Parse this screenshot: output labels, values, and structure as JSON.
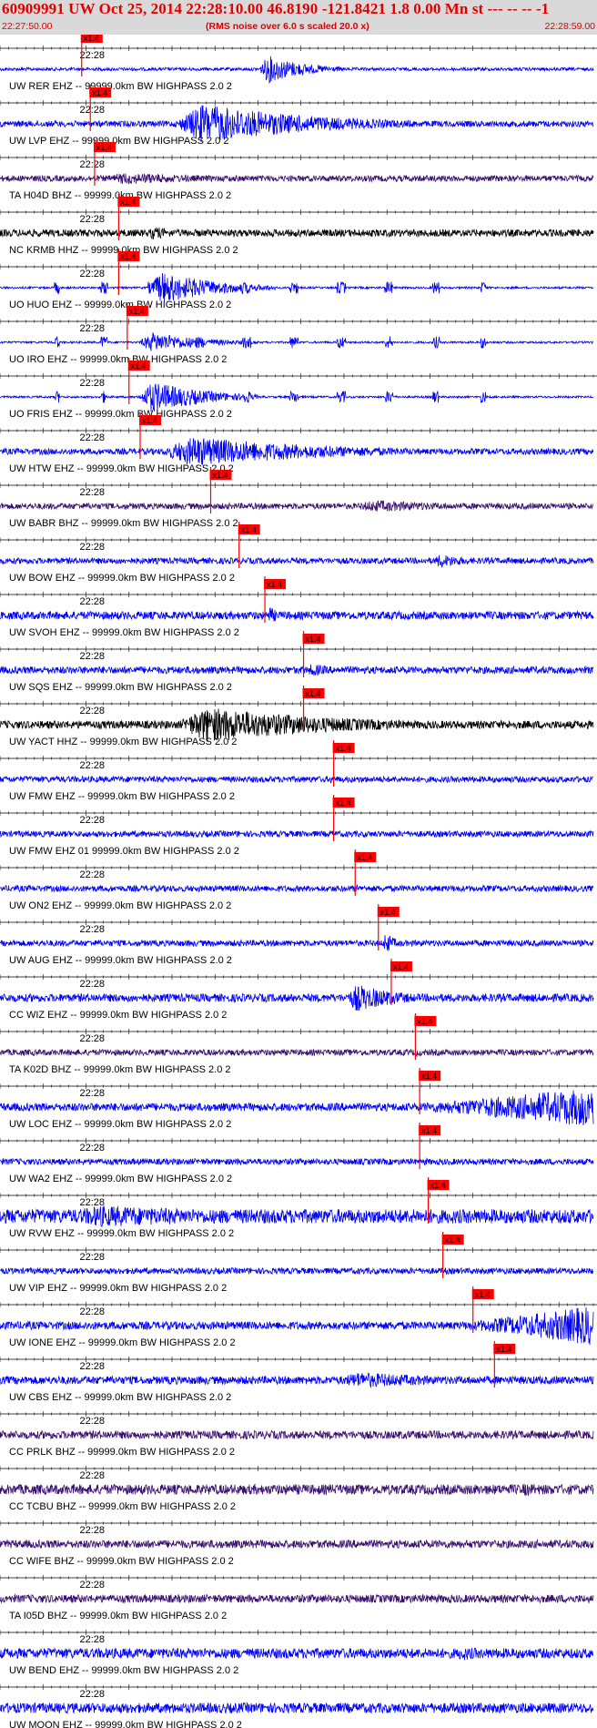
{
  "header": {
    "title": "60909991 UW Oct 25, 2014 22:28:10.00   46.8190 -121.8421  1.8 0.00 Mn st --- -- --   -1",
    "start_time": "22:27:50.00",
    "note": "(RMS noise over 6.0 s scaled 20.0 x)",
    "end_time": "22:28:59.00"
  },
  "colors": {
    "header_bg": "#d9d9d9",
    "header_text": "#e00000",
    "pick_marker": "#ff0000",
    "trace_blue": "#0000ff",
    "trace_dark": "#000000",
    "trace_purple": "#3a1070"
  },
  "chart_data": {
    "type": "line",
    "x_unit": "seconds",
    "x_range": [
      "22:27:50.00",
      "22:28:59.00"
    ],
    "pick_label": "x1.4",
    "time_label": "22:28",
    "traces": [
      {
        "label": "UW RER EHZ -- 99999.0km BW  HIGHPASS  2.0  2",
        "color": "blue",
        "pick": 9.5,
        "amp": 0.7,
        "noise": 0.08,
        "event_start": 30.0,
        "event_end": 40.0,
        "style": "normal"
      },
      {
        "label": "UW LVP EHZ -- 99999.0km BW  HIGHPASS  2.0  2",
        "color": "blue",
        "pick": 10.5,
        "amp": 1.0,
        "noise": 0.15,
        "event_start": 20.0,
        "event_end": 50.0,
        "style": "normal"
      },
      {
        "label": "TA H04D BHZ -- 99999.0km BW  HIGHPASS  2.0  2",
        "color": "purple",
        "pick": 11.0,
        "amp": 0.3,
        "noise": 0.15,
        "event_start": 11.0,
        "event_end": 40.0,
        "style": "normal"
      },
      {
        "label": "NC KRMB HHZ -- 99999.0km BW  HIGHPASS  2.0  2",
        "color": "dark",
        "pick": 13.8,
        "amp": 0.35,
        "noise": 0.18,
        "event_start": 17.0,
        "event_end": 24.0,
        "style": "normal"
      },
      {
        "label": "UO HUO EHZ -- 99999.0km BW  HIGHPASS  2.0  2",
        "color": "blue",
        "pick": 13.8,
        "amp": 0.8,
        "noise": 0.05,
        "event_start": 17.0,
        "event_end": 32.0,
        "style": "bursty"
      },
      {
        "label": "UO IRO EHZ -- 99999.0km BW  HIGHPASS  2.0  2",
        "color": "blue",
        "pick": 14.8,
        "amp": 0.5,
        "noise": 0.05,
        "event_start": 16.0,
        "event_end": 30.0,
        "style": "bursty"
      },
      {
        "label": "UO FRIS EHZ -- 99999.0km BW  HIGHPASS  2.0  2",
        "color": "blue",
        "pick": 15.0,
        "amp": 0.8,
        "noise": 0.05,
        "event_start": 16.0,
        "event_end": 30.0,
        "style": "bursty"
      },
      {
        "label": "UW HTW EHZ -- 99999.0km BW  HIGHPASS  2.0  2",
        "color": "blue",
        "pick": 16.3,
        "amp": 0.75,
        "noise": 0.15,
        "event_start": 18.0,
        "event_end": 55.0,
        "style": "normal"
      },
      {
        "label": "UW BABR BHZ -- 99999.0km BW  HIGHPASS  2.0  2",
        "color": "purple",
        "pick": 24.5,
        "amp": 0.3,
        "noise": 0.15,
        "event_start": 40.0,
        "event_end": 69.0,
        "style": "normal"
      },
      {
        "label": "UW BOW EHZ -- 99999.0km BW  HIGHPASS  2.0  2",
        "color": "blue",
        "pick": 27.8,
        "amp": 0.35,
        "noise": 0.15,
        "event_start": 50.0,
        "event_end": 60.0,
        "style": "normal"
      },
      {
        "label": "UW SVOH EHZ -- 99999.0km BW  HIGHPASS  2.0  2",
        "color": "blue",
        "pick": 30.8,
        "amp": 0.45,
        "noise": 0.2,
        "event_start": 31.0,
        "event_end": 34.0,
        "style": "normal"
      },
      {
        "label": "UW SQS EHZ -- 99999.0km BW  HIGHPASS  2.0  2",
        "color": "blue",
        "pick": 35.3,
        "amp": 0.35,
        "noise": 0.18,
        "event_start": 35.5,
        "event_end": 42.0,
        "style": "normal"
      },
      {
        "label": "UW YACT HHZ -- 99999.0km BW  HIGHPASS  2.0  2",
        "color": "dark",
        "pick": 35.3,
        "amp": 0.9,
        "noise": 0.2,
        "event_start": 20.0,
        "event_end": 55.0,
        "style": "normal"
      },
      {
        "label": "UW FMW EHZ -- 99999.0km BW  HIGHPASS  2.0  2",
        "color": "blue",
        "pick": 38.8,
        "amp": 0.2,
        "noise": 0.15,
        "event_start": 38.0,
        "event_end": 42.0,
        "style": "normal"
      },
      {
        "label": "UW FMW EHZ 01 99999.0km BW  HIGHPASS  2.0  2",
        "color": "blue",
        "pick": 38.8,
        "amp": 0.2,
        "noise": 0.15,
        "event_start": 38.0,
        "event_end": 42.0,
        "style": "normal"
      },
      {
        "label": "UW ON2 EHZ -- 99999.0km BW  HIGHPASS  2.0  2",
        "color": "blue",
        "pick": 41.3,
        "amp": 0.2,
        "noise": 0.15,
        "event_start": 41.0,
        "event_end": 45.0,
        "style": "normal"
      },
      {
        "label": "UW AUG EHZ -- 99999.0km BW  HIGHPASS  2.0  2",
        "color": "blue",
        "pick": 44.0,
        "amp": 0.6,
        "noise": 0.15,
        "event_start": 44.5,
        "event_end": 47.0,
        "style": "normal"
      },
      {
        "label": "CC WIZ EHZ -- 99999.0km BW  HIGHPASS  2.0  2",
        "color": "blue",
        "pick": 45.5,
        "amp": 0.7,
        "noise": 0.2,
        "event_start": 40.0,
        "event_end": 52.0,
        "style": "normal"
      },
      {
        "label": "TA K02D BHZ -- 99999.0km BW  HIGHPASS  2.0  2",
        "color": "purple",
        "pick": 48.3,
        "amp": 0.2,
        "noise": 0.15,
        "event_start": 48.0,
        "event_end": 52.0,
        "style": "normal"
      },
      {
        "label": "UW LOC EHZ -- 99999.0km BW  HIGHPASS  2.0  2",
        "color": "blue",
        "pick": 48.8,
        "amp": 1.0,
        "noise": 0.2,
        "event_start": 38.0,
        "event_end": 69.0,
        "style": "growing"
      },
      {
        "label": "UW WA2 EHZ -- 99999.0km BW  HIGHPASS  2.0  2",
        "color": "blue",
        "pick": 48.8,
        "amp": 0.2,
        "noise": 0.15,
        "event_start": 49.0,
        "event_end": 52.0,
        "style": "normal"
      },
      {
        "label": "UW RVW EHZ -- 99999.0km BW  HIGHPASS  2.0  2",
        "color": "blue",
        "pick": 49.8,
        "amp": 0.55,
        "noise": 0.35,
        "event_start": 5.0,
        "event_end": 60.0,
        "style": "normal"
      },
      {
        "label": "UW VIP EHZ -- 99999.0km BW  HIGHPASS  2.0  2",
        "color": "blue",
        "pick": 51.5,
        "amp": 0.2,
        "noise": 0.15,
        "event_start": 51.0,
        "event_end": 55.0,
        "style": "normal"
      },
      {
        "label": "UW IONE EHZ -- 99999.0km BW  HIGHPASS  2.0  2",
        "color": "blue",
        "pick": 55.0,
        "amp": 1.0,
        "noise": 0.2,
        "event_start": 46.0,
        "event_end": 69.0,
        "style": "growing"
      },
      {
        "label": "UW CBS EHZ -- 99999.0km BW  HIGHPASS  2.0  2",
        "color": "blue",
        "pick": 57.5,
        "amp": 0.4,
        "noise": 0.2,
        "event_start": 38.0,
        "event_end": 69.0,
        "style": "normal"
      },
      {
        "label": "CC PRLK BHZ -- 99999.0km BW  HIGHPASS  2.0  2",
        "color": "purple",
        "pick": null,
        "amp": 0.2,
        "noise": 0.2,
        "event_start": 0,
        "event_end": 0,
        "style": "normal"
      },
      {
        "label": "CC TCBU BHZ -- 99999.0km BW  HIGHPASS  2.0  2",
        "color": "purple",
        "pick": null,
        "amp": 0.35,
        "noise": 0.25,
        "event_start": 60.0,
        "event_end": 69.0,
        "style": "normal"
      },
      {
        "label": "CC WIFE BHZ -- 99999.0km BW  HIGHPASS  2.0  2",
        "color": "purple",
        "pick": null,
        "amp": 0.2,
        "noise": 0.2,
        "event_start": 0,
        "event_end": 0,
        "style": "normal"
      },
      {
        "label": "TA I05D BHZ -- 99999.0km BW  HIGHPASS  2.0  2",
        "color": "purple",
        "pick": null,
        "amp": 0.2,
        "noise": 0.2,
        "event_start": 0,
        "event_end": 0,
        "style": "normal"
      },
      {
        "label": "UW BEND EHZ -- 99999.0km BW  HIGHPASS  2.0  2",
        "color": "blue",
        "pick": null,
        "amp": 0.35,
        "noise": 0.25,
        "event_start": 52.0,
        "event_end": 66.0,
        "style": "normal"
      },
      {
        "label": "UW MOON EHZ -- 99999.0km BW  HIGHPASS  2.0  2",
        "color": "blue",
        "pick": null,
        "amp": 0.3,
        "noise": 0.25,
        "event_start": 0,
        "event_end": 0,
        "style": "normal"
      }
    ]
  }
}
